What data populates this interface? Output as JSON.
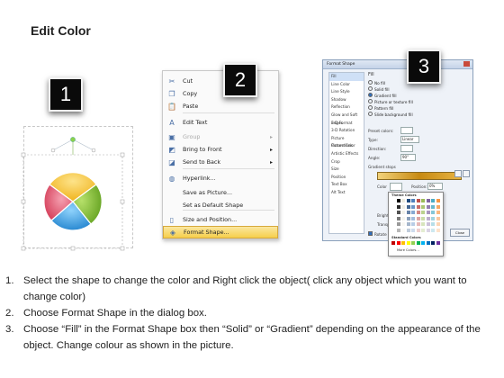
{
  "title": "Edit Color",
  "badges": [
    "1",
    "2",
    "3"
  ],
  "menu": {
    "items": [
      {
        "label": "Cut",
        "icon": "scissors-icon",
        "glyph": "✂",
        "enabled": true
      },
      {
        "label": "Copy",
        "icon": "copy-icon",
        "glyph": "❐",
        "enabled": true
      },
      {
        "label": "Paste",
        "icon": "paste-icon",
        "glyph": "📋",
        "enabled": true
      },
      {
        "label": "Edit Text",
        "icon": "edit-text-icon",
        "glyph": "A",
        "enabled": true
      },
      {
        "label": "Group",
        "icon": "group-icon",
        "glyph": "▣",
        "enabled": false,
        "submenu": true
      },
      {
        "label": "Bring to Front",
        "icon": "bring-front-icon",
        "glyph": "◩",
        "enabled": true,
        "submenu": true
      },
      {
        "label": "Send to Back",
        "icon": "send-back-icon",
        "glyph": "◪",
        "enabled": true,
        "submenu": true
      },
      {
        "label": "Hyperlink...",
        "icon": "globe-icon",
        "glyph": "◍",
        "enabled": true
      },
      {
        "label": "Save as Picture...",
        "icon": "",
        "glyph": "",
        "enabled": true
      },
      {
        "label": "Set as Default Shape",
        "icon": "",
        "glyph": "",
        "enabled": true
      },
      {
        "label": "Size and Position...",
        "icon": "size-icon",
        "glyph": "▯",
        "enabled": true
      },
      {
        "label": "Format Shape...",
        "icon": "format-shape-icon",
        "glyph": "◈",
        "enabled": true,
        "highlighted": true
      }
    ]
  },
  "dialog": {
    "title": "Format Shape",
    "categories": [
      "Fill",
      "Line Color",
      "Line Style",
      "Shadow",
      "Reflection",
      "Glow and Soft Edges",
      "3-D Format",
      "3-D Rotation",
      "Picture Corrections",
      "Picture Color",
      "Artistic Effects",
      "Crop",
      "Size",
      "Position",
      "Text Box",
      "Alt Text"
    ],
    "section": "Fill",
    "fill_options": [
      "No fill",
      "Solid fill",
      "Gradient fill",
      "Picture or texture fill",
      "Pattern fill",
      "Slide background fill"
    ],
    "preset_label": "Preset colors:",
    "type_label": "Type:",
    "type_value": "Linear",
    "direction_label": "Direction:",
    "angle_label": "Angle:",
    "angle_value": "90°",
    "stops_label": "Gradient stops",
    "color_label": "Color",
    "position_label": "Position:",
    "position_value": "0%",
    "brightness_label": "Brightness:",
    "transparency_label": "Transparency:",
    "rotate_label": "Rotate with shape",
    "close_label": "Close",
    "palette_theme": "Theme Colors",
    "palette_standard": "Standard Colors",
    "palette_more": "More Colors..."
  },
  "instructions": [
    {
      "n": "1.",
      "text": "Select the shape to change the color and Right click the object( click any object which you want to change color)"
    },
    {
      "n": "2.",
      "text": "Choose Format Shape in the dialog box."
    },
    {
      "n": "3.",
      "text": "Choose “Fill” in the Format Shape box then “Solid” or “Gradient” depending on the appearance of the object. Change colour as shown in the picture."
    }
  ],
  "pie_colors": {
    "yellow": "#f6c533",
    "green": "#7dbb2e",
    "blue": "#2b9ae0",
    "red": "#e0455e"
  }
}
